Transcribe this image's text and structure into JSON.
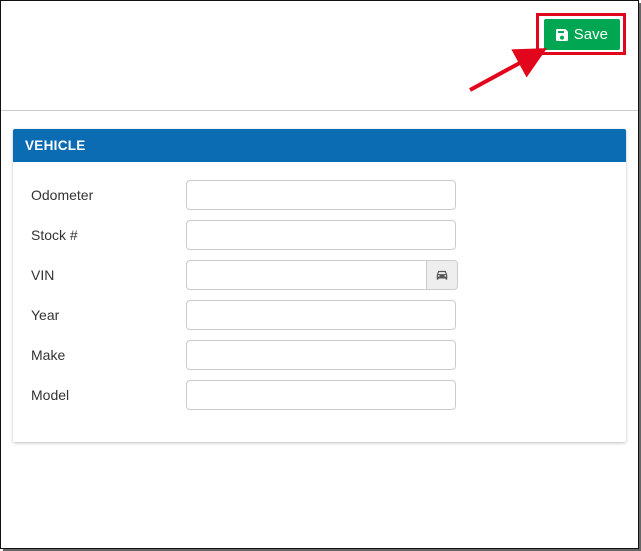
{
  "toolbar": {
    "save_label": "Save"
  },
  "panel": {
    "title": "VEHICLE"
  },
  "fields": {
    "odometer": {
      "label": "Odometer",
      "value": ""
    },
    "stock": {
      "label": "Stock #",
      "value": ""
    },
    "vin": {
      "label": "VIN",
      "value": ""
    },
    "year": {
      "label": "Year",
      "value": ""
    },
    "make": {
      "label": "Make",
      "value": ""
    },
    "model": {
      "label": "Model",
      "value": ""
    }
  },
  "icons": {
    "save": "save-icon",
    "car": "car-icon"
  },
  "annotation": {
    "highlight_color": "#e2061d",
    "arrow_color": "#e2061d"
  }
}
